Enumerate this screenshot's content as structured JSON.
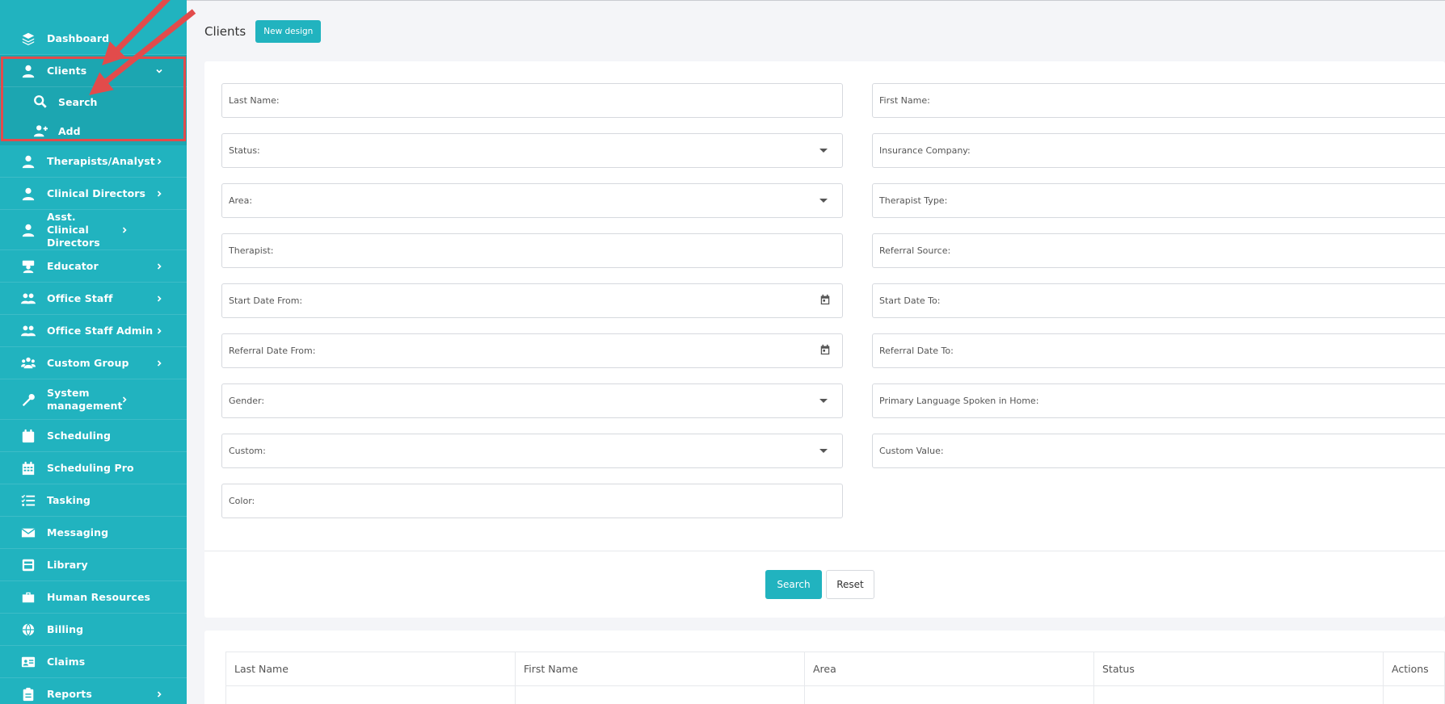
{
  "sidebar": {
    "items": [
      {
        "label": "Dashboard",
        "icon": "layers-icon"
      },
      {
        "label": "Clients",
        "icon": "user-icon"
      },
      {
        "label": "Therapists/Analyst",
        "icon": "user-tie-icon"
      },
      {
        "label": "Clinical Directors",
        "icon": "user-tie-icon"
      },
      {
        "label": "Asst. Clinical Directors",
        "icon": "user-tie-icon"
      },
      {
        "label": "Educator",
        "icon": "teacher-icon"
      },
      {
        "label": "Office Staff",
        "icon": "users-icon"
      },
      {
        "label": "Office Staff Admin",
        "icon": "users-icon"
      },
      {
        "label": "Custom Group",
        "icon": "group-icon"
      },
      {
        "label": "System management",
        "icon": "wrench-icon"
      },
      {
        "label": "Scheduling",
        "icon": "calendar-icon"
      },
      {
        "label": "Scheduling Pro",
        "icon": "calendar-grid-icon"
      },
      {
        "label": "Tasking",
        "icon": "tasks-icon"
      },
      {
        "label": "Messaging",
        "icon": "envelope-icon"
      },
      {
        "label": "Library",
        "icon": "archive-icon"
      },
      {
        "label": "Human Resources",
        "icon": "briefcase-icon"
      },
      {
        "label": "Billing",
        "icon": "globe-icon"
      },
      {
        "label": "Claims",
        "icon": "id-card-icon"
      },
      {
        "label": "Reports",
        "icon": "clipboard-icon"
      }
    ],
    "clients_sub": [
      {
        "label": "Search",
        "icon": "search-icon"
      },
      {
        "label": "Add",
        "icon": "user-plus-icon"
      }
    ]
  },
  "header": {
    "title": "Clients",
    "new_design_label": "New design"
  },
  "filters": {
    "last_name": "Last Name:",
    "first_name": "First Name:",
    "status": "Status:",
    "insurance_company": "Insurance Company:",
    "area": "Area:",
    "therapist_type": "Therapist Type:",
    "therapist": "Therapist:",
    "referral_source": "Referral Source:",
    "start_date_from": "Start Date From:",
    "start_date_to": "Start Date To:",
    "referral_date_from": "Referral Date From:",
    "referral_date_to": "Referral Date To:",
    "gender": "Gender:",
    "primary_language": "Primary Language Spoken in Home:",
    "custom": "Custom:",
    "custom_value": "Custom Value:",
    "color": "Color:"
  },
  "actions": {
    "search_label": "Search",
    "reset_label": "Reset"
  },
  "table": {
    "columns": [
      "Last Name",
      "First Name",
      "Area",
      "Status",
      "Actions"
    ]
  },
  "colors": {
    "accent": "#21b3bf",
    "highlight": "#e24b4b"
  }
}
